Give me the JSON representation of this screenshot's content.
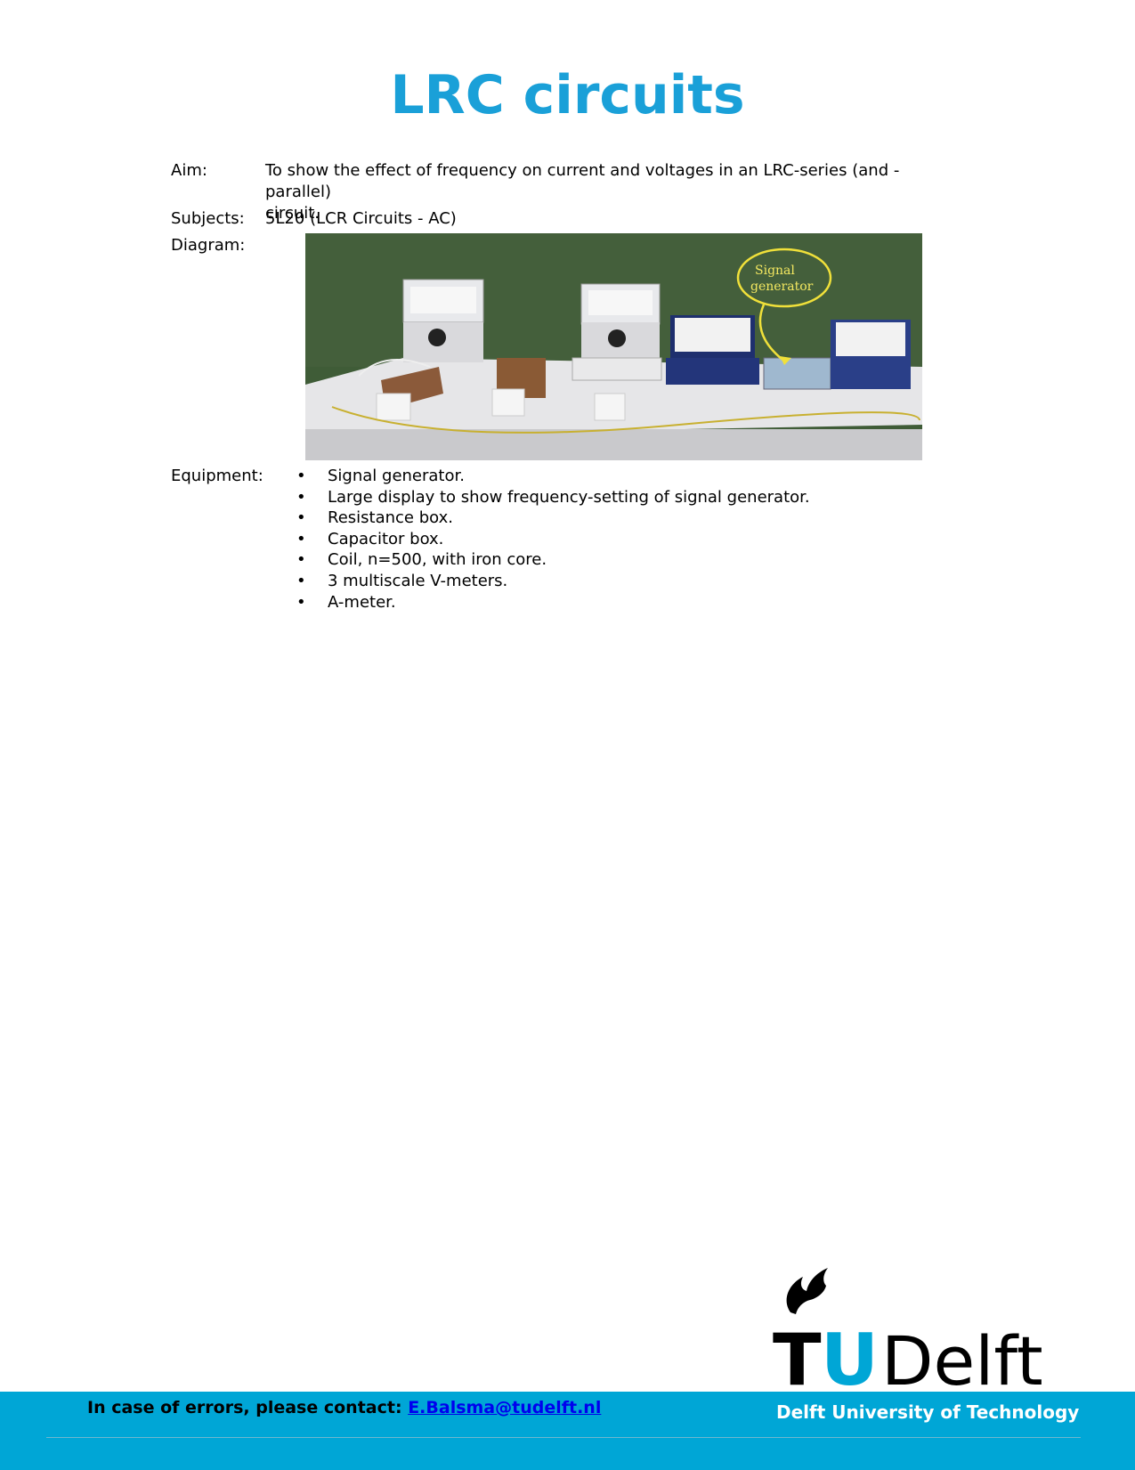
{
  "title": "LRC circuits",
  "aim": {
    "label": "Aim:",
    "line1": "To show the effect of frequency on current and voltages in an LRC-series (and -parallel)",
    "line2": "circuit."
  },
  "subjects": {
    "label": "Subjects:",
    "value": "5L20 (LCR Circuits - AC)"
  },
  "diagram": {
    "label": "Diagram:",
    "annotation_line1": "Signal",
    "annotation_line2": "generator"
  },
  "equipment": {
    "label": "Equipment:",
    "items": [
      "Signal generator.",
      "Large display to show frequency-setting of signal generator.",
      "Resistance box.",
      "Capacitor box.",
      "Coil, n=500, with iron core.",
      "3 multiscale V-meters.",
      "A-meter."
    ]
  },
  "logo": {
    "text_t": "T",
    "text_u": "U",
    "text_delft": "Delft"
  },
  "footer": {
    "contact_prefix": "In case of errors, please contact:",
    "contact_email": "E.Balsma@tudelft.nl",
    "university": "Delft University of Technology"
  },
  "colors": {
    "title": "#1aa0d8",
    "band": "#00a6d6",
    "link": "#0000ee"
  }
}
